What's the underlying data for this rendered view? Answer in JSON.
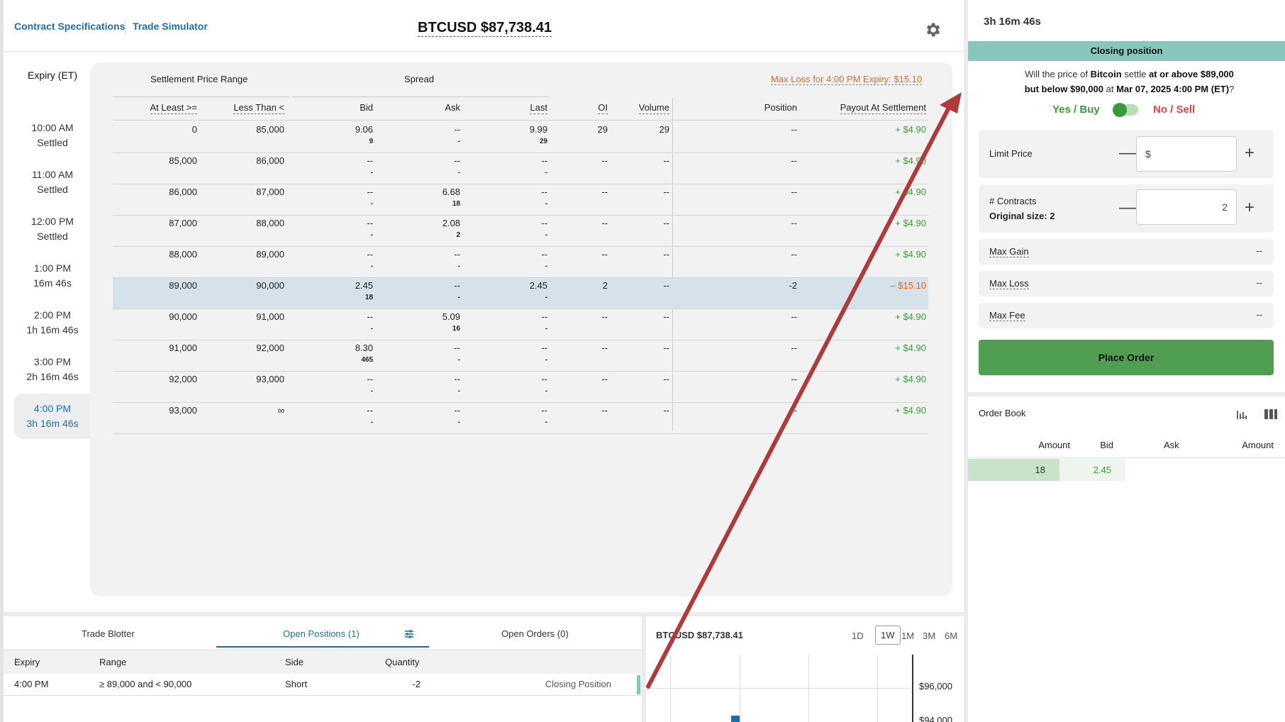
{
  "header": {
    "nav_contract_specs": "Contract Specifications",
    "nav_trade_simulator": "Trade Simulator",
    "ticker": "BTCUSD $87,738.41",
    "settings_icon": "gear-icon"
  },
  "expiry": {
    "title": "Expiry (ET)",
    "items": [
      {
        "time": "10:00 AM",
        "status": "Settled"
      },
      {
        "time": "11:00 AM",
        "status": "Settled"
      },
      {
        "time": "12:00 PM",
        "status": "Settled"
      },
      {
        "time": "1:00 PM",
        "status": "16m 46s"
      },
      {
        "time": "2:00 PM",
        "status": "1h 16m 46s"
      },
      {
        "time": "3:00 PM",
        "status": "2h 16m 46s"
      },
      {
        "time": "4:00 PM",
        "status": "3h 16m 46s"
      }
    ],
    "selected_index": 6
  },
  "grid": {
    "group_settlement": "Settlement Price Range",
    "group_spread": "Spread",
    "max_loss": "Max Loss for 4:00 PM Expiry: $15.10",
    "columns": {
      "at_least": "At Least >=",
      "less_than": "Less Than <",
      "bid": "Bid",
      "ask": "Ask",
      "last": "Last",
      "oi": "OI",
      "volume": "Volume",
      "position": "Position",
      "payout": "Payout At Settlement"
    },
    "rows": [
      {
        "at_least": "0",
        "less_than": "85,000",
        "bid": "9.06",
        "bid_size": "9",
        "ask": "--",
        "ask_size": "-",
        "last": "9.99",
        "last_size": "29",
        "oi": "29",
        "volume": "29",
        "position": "--",
        "payout": "+ $4.90"
      },
      {
        "at_least": "85,000",
        "less_than": "86,000",
        "bid": "--",
        "bid_size": "-",
        "ask": "--",
        "ask_size": "-",
        "last": "--",
        "last_size": "-",
        "oi": "--",
        "volume": "--",
        "position": "--",
        "payout": "+ $4.90"
      },
      {
        "at_least": "86,000",
        "less_than": "87,000",
        "bid": "--",
        "bid_size": "-",
        "ask": "6.68",
        "ask_size": "18",
        "last": "--",
        "last_size": "-",
        "oi": "--",
        "volume": "--",
        "position": "--",
        "payout": "+ $4.90"
      },
      {
        "at_least": "87,000",
        "less_than": "88,000",
        "bid": "--",
        "bid_size": "-",
        "ask": "2.08",
        "ask_size": "2",
        "last": "--",
        "last_size": "-",
        "oi": "--",
        "volume": "--",
        "position": "--",
        "payout": "+ $4.90"
      },
      {
        "at_least": "88,000",
        "less_than": "89,000",
        "bid": "--",
        "bid_size": "-",
        "ask": "--",
        "ask_size": "-",
        "last": "--",
        "last_size": "-",
        "oi": "--",
        "volume": "--",
        "position": "--",
        "payout": "+ $4.90"
      },
      {
        "at_least": "89,000",
        "less_than": "90,000",
        "bid": "2.45",
        "bid_size": "18",
        "ask": "--",
        "ask_size": "-",
        "last": "2.45",
        "last_size": "-",
        "oi": "2",
        "volume": "--",
        "position": "-2",
        "payout": "– $15.10"
      },
      {
        "at_least": "90,000",
        "less_than": "91,000",
        "bid": "--",
        "bid_size": "-",
        "ask": "5.09",
        "ask_size": "16",
        "last": "--",
        "last_size": "-",
        "oi": "--",
        "volume": "--",
        "position": "--",
        "payout": "+ $4.90"
      },
      {
        "at_least": "91,000",
        "less_than": "92,000",
        "bid": "8.30",
        "bid_size": "465",
        "ask": "--",
        "ask_size": "-",
        "last": "--",
        "last_size": "-",
        "oi": "--",
        "volume": "--",
        "position": "--",
        "payout": "+ $4.90"
      },
      {
        "at_least": "92,000",
        "less_than": "93,000",
        "bid": "--",
        "bid_size": "-",
        "ask": "--",
        "ask_size": "-",
        "last": "--",
        "last_size": "-",
        "oi": "--",
        "volume": "--",
        "position": "--",
        "payout": "+ $4.90"
      },
      {
        "at_least": "93,000",
        "less_than": "∞",
        "bid": "--",
        "bid_size": "-",
        "ask": "--",
        "ask_size": "-",
        "last": "--",
        "last_size": "-",
        "oi": "--",
        "volume": "--",
        "position": "--",
        "payout": "+ $4.90"
      }
    ],
    "selected_row": 5
  },
  "order_panel": {
    "timer": "3h 16m 46s",
    "closing_banner": "Closing position",
    "question": {
      "p1": "Will the price of ",
      "asset": "Bitcoin",
      "p2": " settle ",
      "cond1": "at or above $89,000",
      "cond2": "but below $90,000",
      "p3": " at ",
      "date": "Mar 07, 2025 4:00 PM (ET)",
      "p4": "?"
    },
    "yes_label": "Yes / Buy",
    "no_label": "No / Sell",
    "limit_price_label": "Limit Price",
    "limit_price_prefix": "$",
    "limit_price_value": "",
    "contracts_label": "# Contracts",
    "original_size": "Original size: 2",
    "contracts_value": "2",
    "max_gain_label": "Max Gain",
    "max_gain_value": "--",
    "max_loss_label": "Max Loss",
    "max_loss_value": "--",
    "max_fee_label": "Max Fee",
    "max_fee_value": "--",
    "place_order": "Place Order"
  },
  "order_book": {
    "title": "Order Book",
    "headers": [
      "Amount",
      "Bid",
      "Ask",
      "Amount"
    ],
    "bid_amount": "18",
    "bid_price": "2.45"
  },
  "bottom": {
    "tabs": [
      "Trade Blotter",
      "Open Positions (1)",
      "Open Orders (0)"
    ],
    "active_tab": 1,
    "headers": [
      "Expiry",
      "Range",
      "Side",
      "Quantity"
    ],
    "row": {
      "expiry": "4:00 PM",
      "range": "≥ 89,000 and < 90,000",
      "side": "Short",
      "quantity": "-2",
      "status": "Closing Position"
    }
  },
  "mini_chart": {
    "title": "BTCUSD $87,738.41",
    "ranges": [
      "1D",
      "1W",
      "1M",
      "3M",
      "6M"
    ],
    "selected_range": "1W",
    "y_labels": [
      "$96,000",
      "$94,000"
    ]
  },
  "colors": {
    "accent_blue": "#1a6fb0",
    "positive": "#3a9a3a",
    "negative": "#e06a1a",
    "place_order": "#4f9e52",
    "banner": "#88c5bd",
    "arrow": "#b03a3a"
  }
}
